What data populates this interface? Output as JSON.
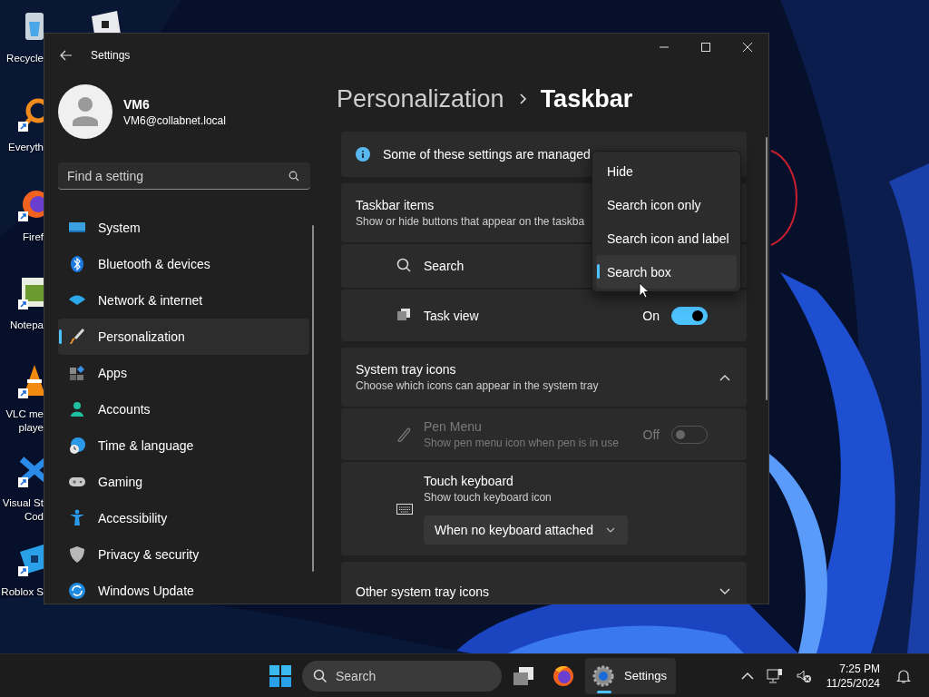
{
  "desktop_icons": [
    {
      "label_lines": [
        "Recycle"
      ],
      "shortcut": false
    },
    {
      "shortcut": false
    },
    {
      "label_lines": [
        "Everyth"
      ],
      "shortcut": true
    },
    {
      "label_lines": [
        "Firef"
      ],
      "shortcut": true
    },
    {
      "label_lines": [
        "Notepa"
      ],
      "shortcut": true
    },
    {
      "label_lines": [
        "VLC me",
        "playe"
      ],
      "shortcut": true
    },
    {
      "label_lines": [
        "Visual St",
        "Cod"
      ],
      "shortcut": true
    },
    {
      "label_lines": [
        "Roblox S"
      ],
      "shortcut": true
    }
  ],
  "window": {
    "title": "Settings"
  },
  "account": {
    "name": "VM6",
    "email": "VM6@collabnet.local"
  },
  "sidebar": {
    "search_placeholder": "Find a setting",
    "items": [
      {
        "label": "System",
        "selected": false
      },
      {
        "label": "Bluetooth & devices",
        "selected": false
      },
      {
        "label": "Network & internet",
        "selected": false
      },
      {
        "label": "Personalization",
        "selected": true
      },
      {
        "label": "Apps",
        "selected": false
      },
      {
        "label": "Accounts",
        "selected": false
      },
      {
        "label": "Time & language",
        "selected": false
      },
      {
        "label": "Gaming",
        "selected": false
      },
      {
        "label": "Accessibility",
        "selected": false
      },
      {
        "label": "Privacy & security",
        "selected": false
      },
      {
        "label": "Windows Update",
        "selected": false
      }
    ]
  },
  "breadcrumb": [
    "Personalization",
    "Taskbar"
  ],
  "info_bar": {
    "text": "Some of these settings are managed"
  },
  "sections": [
    {
      "title": "Taskbar items",
      "subtitle": "Show or hide buttons that appear on the taskba",
      "rows": [
        {
          "kind": "dropdown",
          "label": "Search"
        },
        {
          "kind": "toggle",
          "label": "Task view",
          "on": true,
          "state_label": "On",
          "disabled": false
        }
      ]
    },
    {
      "title": "System tray icons",
      "subtitle": "Choose which icons can appear in the system tray",
      "expanded": true,
      "rows": [
        {
          "kind": "toggle",
          "label": "Pen Menu",
          "description": "Show pen menu icon when pen is in use",
          "on": false,
          "state_label": "Off",
          "disabled": true
        },
        {
          "kind": "select",
          "label": "Touch keyboard",
          "description": "Show touch keyboard icon",
          "value": "When no keyboard attached"
        }
      ]
    },
    {
      "title": "Other system tray icons",
      "expanded": false
    }
  ],
  "open_menu": {
    "options": [
      {
        "label": "Hide",
        "selected": false
      },
      {
        "label": "Search icon only",
        "selected": false
      },
      {
        "label": "Search icon and label",
        "selected": false
      },
      {
        "label": "Search box",
        "selected": true
      }
    ]
  },
  "taskbar": {
    "search_placeholder": "Search",
    "apps": [
      {
        "running": false
      },
      {
        "running": false
      },
      {
        "label": "Settings",
        "running": true
      }
    ],
    "clock": {
      "time": "7:25 PM",
      "date": "11/25/2024"
    }
  }
}
